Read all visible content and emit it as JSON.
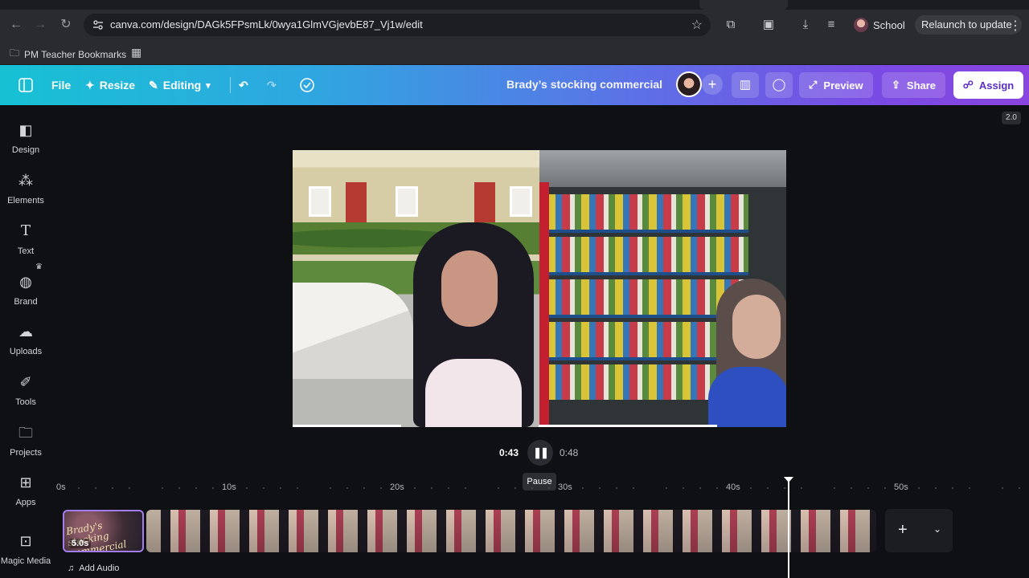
{
  "browser": {
    "url": "canva.com/design/DAGk5FPsmLk/0wya1GlmVGjevbE87_Vj1w/edit",
    "profile_label": "School",
    "relaunch_label": "Relaunch to update",
    "bookmark_folder": "PM Teacher Bookmarks"
  },
  "header": {
    "file_label": "File",
    "resize_label": "Resize",
    "editing_label": "Editing",
    "design_title": "Brady’s stocking commercial",
    "preview_label": "Preview",
    "share_label": "Share",
    "assign_label": "Assign"
  },
  "sidebar": {
    "items": [
      {
        "label": "Design",
        "icon": "design-icon"
      },
      {
        "label": "Elements",
        "icon": "elements-icon"
      },
      {
        "label": "Text",
        "icon": "text-icon"
      },
      {
        "label": "Brand",
        "icon": "brand-icon"
      },
      {
        "label": "Uploads",
        "icon": "uploads-icon"
      },
      {
        "label": "Tools",
        "icon": "tools-icon"
      },
      {
        "label": "Projects",
        "icon": "projects-icon"
      },
      {
        "label": "Apps",
        "icon": "apps-icon"
      },
      {
        "label": "Magic Media",
        "icon": "magic-media-icon"
      }
    ]
  },
  "canvas": {
    "zoom_badge": "2.0"
  },
  "playback": {
    "current_time": "0:43",
    "total_time": "0:48",
    "tooltip": "Pause"
  },
  "timeline": {
    "ruler_labels": [
      "0s",
      "10s",
      "20s",
      "30s",
      "40s",
      "50s"
    ],
    "title_clip_text": "Brady's stocking commercial",
    "title_clip_duration": "5.0s",
    "add_audio_label": "Add Audio"
  },
  "colors": {
    "accent_purple": "#8a44e0",
    "header_cyan": "#17c1d4",
    "selection_border": "#a37cf2"
  }
}
